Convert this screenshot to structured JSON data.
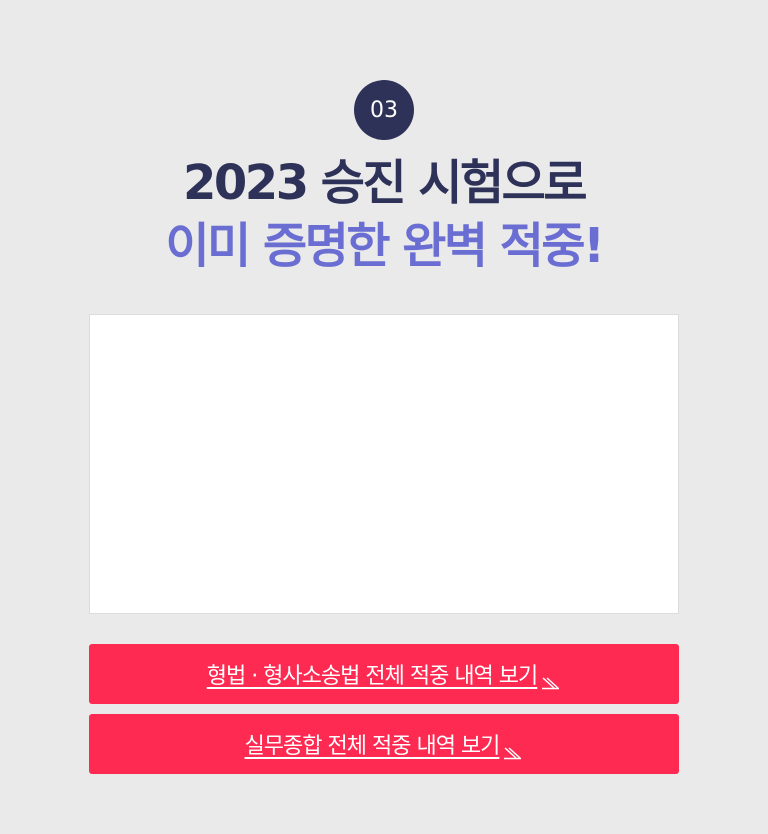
{
  "badge": {
    "number": "03"
  },
  "headline": {
    "line1": "2023 승진 시험으로",
    "line2": "이미 증명한 완벽 적중!"
  },
  "buttons": {
    "criminal_law": "형법 · 형사소송법 전체 적중 내역 보기",
    "practical": "실무종합 전체 적중 내역 보기 "
  },
  "icons": {
    "button_arrow": "diagonal-arrow-icon"
  },
  "colors": {
    "background": "#eaeaea",
    "navy": "#2f3258",
    "purple": "#6a6dd2",
    "cta_red": "#ff2a52"
  }
}
